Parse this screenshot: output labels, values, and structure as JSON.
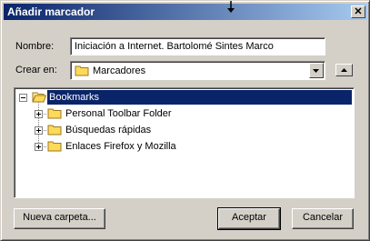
{
  "window": {
    "title": "Añadir marcador"
  },
  "form": {
    "name_label": "Nombre:",
    "name_value": "Iniciación a Internet. Bartolomé Sintes Marco",
    "create_in_label": "Crear en:",
    "create_in_value": "Marcadores"
  },
  "tree": {
    "root": {
      "label": "Bookmarks",
      "expanded": true,
      "selected": true
    },
    "children": [
      {
        "label": "Personal Toolbar Folder",
        "expanded": false
      },
      {
        "label": "Búsquedas rápidas",
        "expanded": false
      },
      {
        "label": "Enlaces Firefox y Mozilla",
        "expanded": false
      }
    ]
  },
  "buttons": {
    "new_folder": "Nueva carpeta...",
    "accept": "Aceptar",
    "cancel": "Cancelar"
  },
  "colors": {
    "titlebar_start": "#0a246a",
    "titlebar_end": "#a6caf0",
    "face": "#d4d0c8",
    "selection": "#0a246a",
    "folder": "#ffd95a"
  }
}
